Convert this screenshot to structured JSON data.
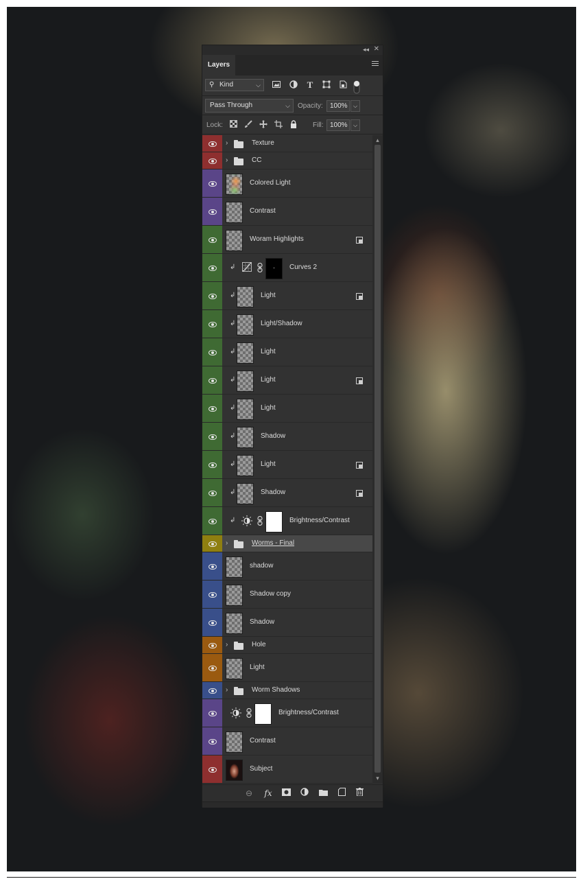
{
  "panel": {
    "tab_label": "Layers",
    "filter": {
      "kind_label": "Kind"
    },
    "blend_mode": "Pass Through",
    "opacity_label": "Opacity:",
    "opacity_value": "100%",
    "lock_label": "Lock:",
    "fill_label": "Fill:",
    "fill_value": "100%"
  },
  "layers": [
    {
      "name": "Texture",
      "type": "group",
      "color": "#8e2f2f"
    },
    {
      "name": "CC",
      "type": "group",
      "color": "#8e2f2f"
    },
    {
      "name": "Colored Light",
      "type": "pixel",
      "thumb": "colored",
      "color": "#5a4588"
    },
    {
      "name": "Contrast",
      "type": "pixel",
      "color": "#5a4588"
    },
    {
      "name": "Woram Highlights",
      "type": "pixel",
      "smart": true,
      "color": "#3f6a33"
    },
    {
      "name": "Curves 2",
      "type": "adjustment",
      "icon": "curves",
      "mask": "black",
      "clip": true,
      "color": "#3f6a33"
    },
    {
      "name": "Light",
      "type": "pixel",
      "clip": true,
      "smart": true,
      "color": "#3f6a33"
    },
    {
      "name": "Light/Shadow",
      "type": "pixel",
      "clip": true,
      "color": "#3f6a33"
    },
    {
      "name": "Light",
      "type": "pixel",
      "clip": true,
      "color": "#3f6a33"
    },
    {
      "name": "Light",
      "type": "pixel",
      "clip": true,
      "smart": true,
      "color": "#3f6a33"
    },
    {
      "name": "Light",
      "type": "pixel",
      "clip": true,
      "color": "#3f6a33"
    },
    {
      "name": "Shadow",
      "type": "pixel",
      "clip": true,
      "color": "#3f6a33"
    },
    {
      "name": "Light",
      "type": "pixel",
      "clip": true,
      "smart": true,
      "color": "#3f6a33"
    },
    {
      "name": "Shadow",
      "type": "pixel",
      "clip": true,
      "smart": true,
      "color": "#3f6a33"
    },
    {
      "name": "Brightness/Contrast",
      "type": "adjustment",
      "icon": "brightness",
      "mask": "white",
      "clip": true,
      "color": "#3f6a33"
    },
    {
      "name": "Worms - Final",
      "type": "group",
      "selected": true,
      "color": "#8f7f10"
    },
    {
      "name": "shadow",
      "type": "pixel",
      "color": "#394f8a"
    },
    {
      "name": "Shadow copy",
      "type": "pixel",
      "color": "#394f8a"
    },
    {
      "name": "Shadow",
      "type": "pixel",
      "color": "#394f8a"
    },
    {
      "name": "Hole",
      "type": "group",
      "color": "#9a5a10"
    },
    {
      "name": "Light",
      "type": "pixel",
      "color": "#9a5a10"
    },
    {
      "name": "Worm Shadows",
      "type": "group",
      "color": "#394f8a"
    },
    {
      "name": "Brightness/Contrast",
      "type": "adjustment",
      "icon": "brightness",
      "mask": "white",
      "color": "#5a4588"
    },
    {
      "name": "Contrast",
      "type": "pixel",
      "color": "#5a4588"
    },
    {
      "name": "Subject",
      "type": "pixel",
      "thumb": "subject",
      "color": "#8e2f2f"
    }
  ]
}
